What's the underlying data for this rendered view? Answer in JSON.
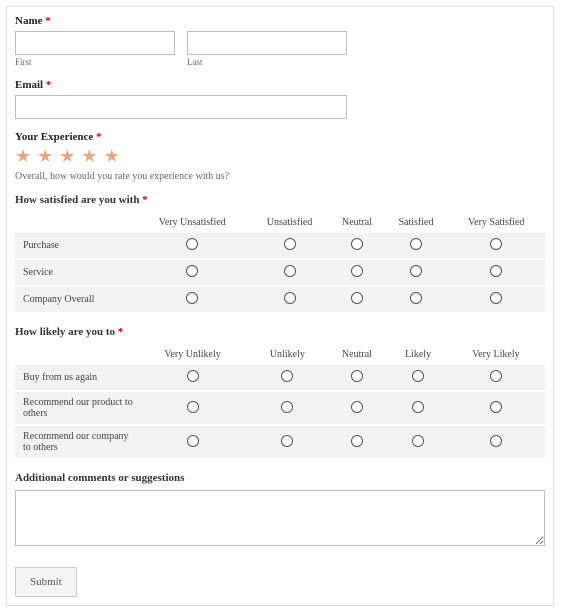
{
  "fields": {
    "name": {
      "label": "Name",
      "required": "*",
      "first_sub": "First",
      "last_sub": "Last"
    },
    "email": {
      "label": "Email",
      "required": "*"
    },
    "experience": {
      "label": "Your Experience",
      "required": "*",
      "desc": "Overall, how would you rate you experience with us?"
    }
  },
  "matrix1": {
    "question": "How satisfied are you with",
    "required": "*",
    "columns": [
      "Very Unsatisfied",
      "Unsatisfied",
      "Neutral",
      "Satisfied",
      "Very Satisfied"
    ],
    "rows": [
      "Purchase",
      "Service",
      "Company Overall"
    ]
  },
  "matrix2": {
    "question": "How likely are you to",
    "required": "*",
    "columns": [
      "Very Unlikely",
      "Unlikely",
      "Neutral",
      "Likely",
      "Very Likely"
    ],
    "rows": [
      "Buy from us again",
      "Recommend our product to others",
      "Recommend our company to others"
    ]
  },
  "comments": {
    "label": "Additional comments or suggestions"
  },
  "submit": {
    "label": "Submit"
  }
}
